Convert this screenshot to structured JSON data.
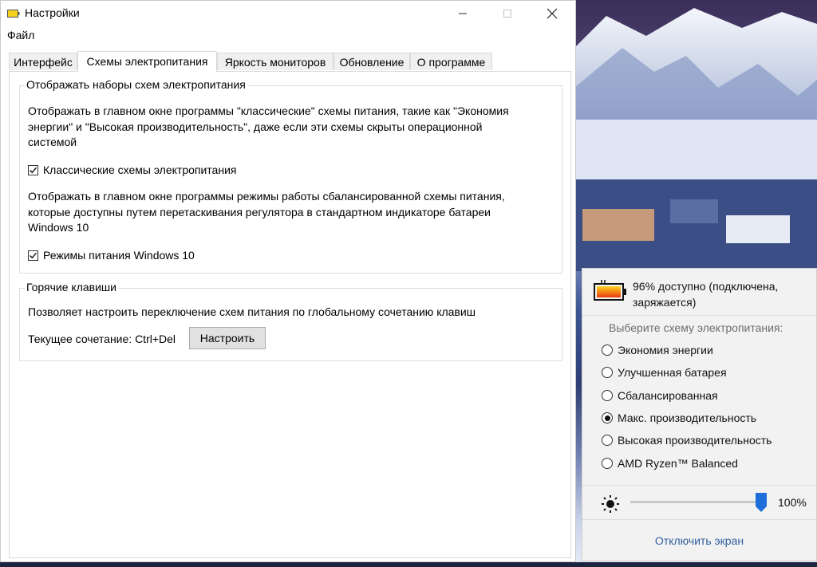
{
  "window": {
    "title": "Настройки",
    "menu": {
      "file": "Файл"
    },
    "tabs": [
      {
        "label": "Интерфейс"
      },
      {
        "label": "Схемы электропитания",
        "active": true
      },
      {
        "label": "Яркость мониторов"
      },
      {
        "label": "Обновление"
      },
      {
        "label": "О программе"
      }
    ]
  },
  "schemes_group": {
    "title": "Отображать наборы схем электропитания",
    "classic_desc_lines": [
      "Отображать в главном окне программы \"классические\" схемы питания, такие как \"Экономия",
      "энергии\" и \"Высокая производительность\", даже если эти схемы скрыты операционной",
      "системой"
    ],
    "classic_checkbox": {
      "label": "Классические схемы электропитания",
      "checked": true
    },
    "modes_desc_lines": [
      "Отображать в главном окне программы режимы работы сбалансированной схемы питания,",
      "которые доступны путем перетаскивания регулятора в стандартном индикаторе батареи",
      "Windows 10"
    ],
    "modes_checkbox": {
      "label": "Режимы питания Windows 10",
      "checked": true
    }
  },
  "hotkeys_group": {
    "title": "Горячие клавиши",
    "desc": "Позволяет настроить переключение схем питания по глобальному сочетанию клавиш",
    "current": "Текущее сочетание: Ctrl+Del",
    "configure_button": "Настроить"
  },
  "flyout": {
    "battery_line1": "96% доступно (подключена,",
    "battery_line2": "заряжается)",
    "prompt": "Выберите схему электропитания:",
    "schemes": [
      {
        "label": "Экономия энергии",
        "selected": false
      },
      {
        "label": "Улучшенная батарея",
        "selected": false
      },
      {
        "label": "Сбалансированная",
        "selected": false
      },
      {
        "label": "Макс. производительность",
        "selected": true
      },
      {
        "label": "Высокая производительность",
        "selected": false
      },
      {
        "label": "AMD Ryzen™ Balanced",
        "selected": false
      }
    ],
    "brightness": {
      "value_label": "100%",
      "level": 1.0
    },
    "turn_off_screen": "Отключить экран"
  },
  "colors": {
    "link": "#2f5f9e",
    "battery_fill_start": "#ffd21e",
    "battery_fill_end": "#e83a12",
    "slider_thumb": "#1e6fd9"
  }
}
